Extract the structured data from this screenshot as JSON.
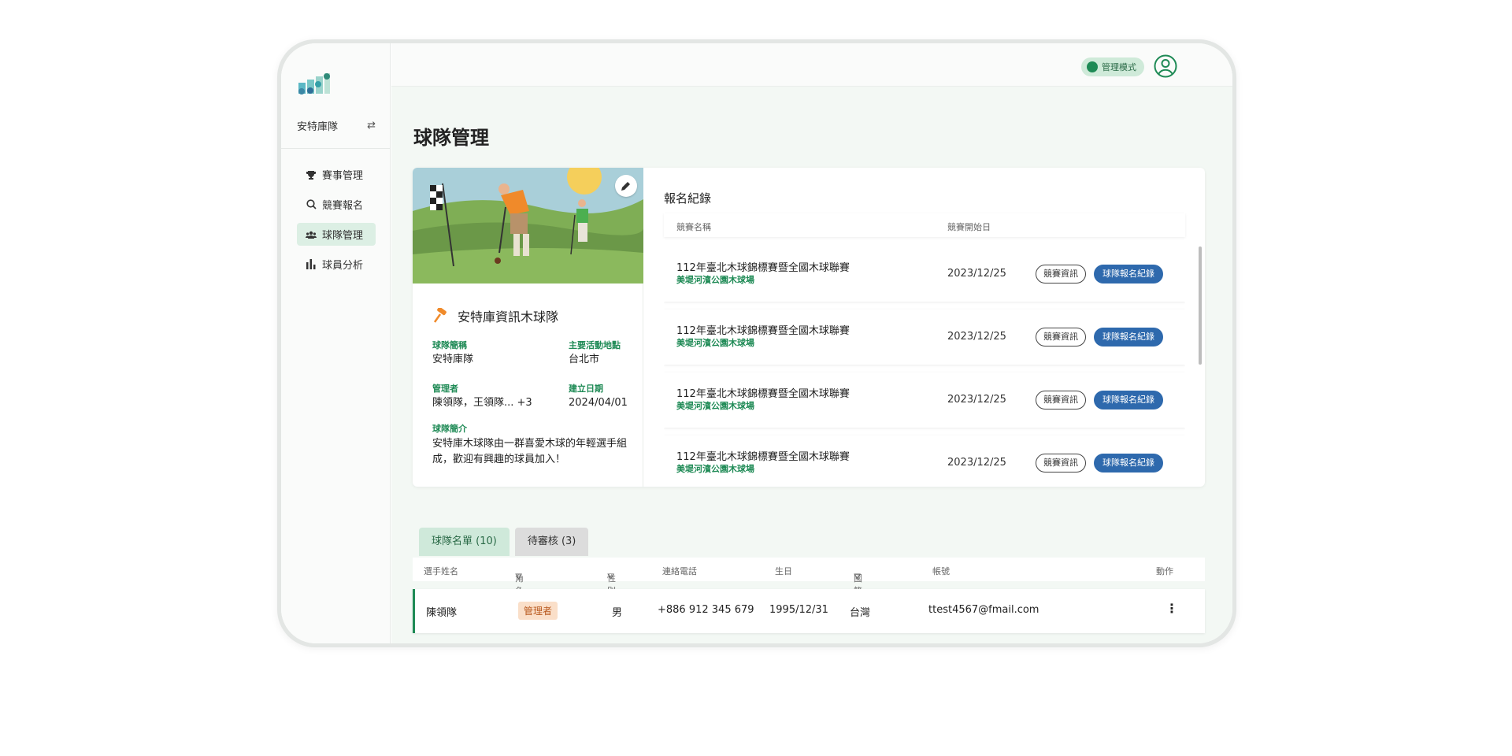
{
  "sidebar": {
    "team_name": "安特庫隊",
    "swap_icon": "swap-icon",
    "items": [
      {
        "label": "賽事管理",
        "icon": "trophy-icon"
      },
      {
        "label": "競賽報名",
        "icon": "search-icon"
      },
      {
        "label": "球隊管理",
        "icon": "users-icon",
        "active": true
      },
      {
        "label": "球員分析",
        "icon": "bar-chart-icon"
      }
    ]
  },
  "topbar": {
    "admin_mode_label": "管理模式"
  },
  "page": {
    "title": "球隊管理"
  },
  "team": {
    "name": "安特庫資訊木球隊",
    "nickname_label": "球隊簡稱",
    "nickname": "安特庫隊",
    "location_label": "主要活動地點",
    "location": "台北市",
    "managers_label": "管理者",
    "managers": "陳領隊，王領隊... +3",
    "founded_label": "建立日期",
    "founded": "2024/04/01",
    "intro_label": "球隊簡介",
    "intro": "安特庫木球隊由一群喜愛木球的年輕選手組成，歡迎有興趣的球員加入！"
  },
  "records": {
    "title": "報名紀錄",
    "col_name": "競賽名稱",
    "col_start": "競賽開始日",
    "rows": [
      {
        "name": "112年臺北木球錦標賽暨全國木球聯賽",
        "venue": "美堤河濱公園木球場",
        "date": "2023/12/25",
        "btn_info": "競賽資訊",
        "btn_record": "球隊報名紀錄"
      },
      {
        "name": "112年臺北木球錦標賽暨全國木球聯賽",
        "venue": "美堤河濱公園木球場",
        "date": "2023/12/25",
        "btn_info": "競賽資訊",
        "btn_record": "球隊報名紀錄"
      },
      {
        "name": "112年臺北木球錦標賽暨全國木球聯賽",
        "venue": "美堤河濱公園木球場",
        "date": "2023/12/25",
        "btn_info": "競賽資訊",
        "btn_record": "球隊報名紀錄"
      },
      {
        "name": "112年臺北木球錦標賽暨全國木球聯賽",
        "venue": "美堤河濱公園木球場",
        "date": "2023/12/25",
        "btn_info": "競賽資訊",
        "btn_record": "球隊報名紀錄"
      }
    ]
  },
  "tabs": [
    {
      "label": "球隊名單 (10)",
      "active": true
    },
    {
      "label": "待審核 (3)",
      "active": false
    }
  ],
  "roster": {
    "headers": {
      "name": "選手姓名",
      "role": "角色",
      "gender": "性別",
      "phone": "連絡電話",
      "birthday": "生日",
      "nationality": "國籍",
      "account": "帳號",
      "action": "動作"
    },
    "rows": [
      {
        "name": "陳領隊",
        "role": "管理者",
        "gender": "男",
        "phone": "+886 912 345 679",
        "birthday": "1995/12/31",
        "nationality": "台灣",
        "account": "ttest4567@fmail.com"
      }
    ]
  },
  "colors": {
    "accent": "#1e8a55",
    "primary_button": "#2e69ad",
    "active_nav": "#dcefe4",
    "role_badge": "#fadfc9"
  }
}
